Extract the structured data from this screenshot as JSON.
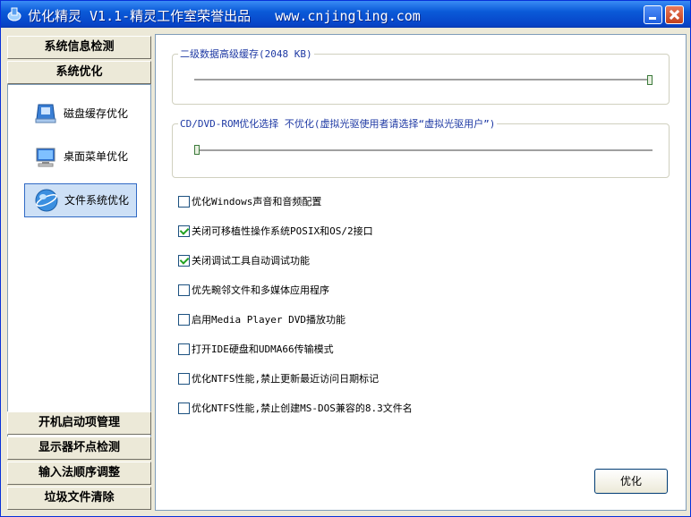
{
  "window": {
    "title": "优化精灵 V1.1-精灵工作室荣誉出品   www.cnjingling.com"
  },
  "sidebar": {
    "top_buttons": [
      {
        "label": "系统信息检测"
      },
      {
        "label": "系统优化"
      }
    ],
    "items": [
      {
        "label": "磁盘缓存优化",
        "icon": "disk-icon",
        "selected": false
      },
      {
        "label": "桌面菜单优化",
        "icon": "monitor-icon",
        "selected": false
      },
      {
        "label": "文件系统优化",
        "icon": "globe-icon",
        "selected": true
      }
    ],
    "bottom_buttons": [
      {
        "label": "开机启动项管理"
      },
      {
        "label": "显示器坏点检测"
      },
      {
        "label": "输入法顺序调整"
      },
      {
        "label": "垃圾文件清除"
      }
    ]
  },
  "main": {
    "l2cache": {
      "label": "二级数据高级缓存(2048 KB)",
      "slider_fraction": 1.0
    },
    "cdrom": {
      "label": "CD/DVD-ROM优化选择 不优化(虚拟光驱使用者请选择“虚拟光驱用户”)",
      "slider_fraction": 0.0
    },
    "options": [
      {
        "label": "优化Windows声音和音频配置",
        "checked": false
      },
      {
        "label": "关闭可移植性操作系统POSIX和OS/2接口",
        "checked": true
      },
      {
        "label": "关闭调试工具自动调试功能",
        "checked": true
      },
      {
        "label": "优先畹邻文件和多媒体应用程序",
        "checked": false
      },
      {
        "label": "启用Media Player DVD播放功能",
        "checked": false
      },
      {
        "label": "打开IDE硬盘和UDMA66传输模式",
        "checked": false
      },
      {
        "label": "优化NTFS性能,禁止更新最近访问日期标记",
        "checked": false
      },
      {
        "label": "优化NTFS性能,禁止创建MS-DOS兼容的8.3文件名",
        "checked": false
      }
    ],
    "optimize_button": "优化"
  },
  "colors": {
    "titlebar": "#0a5ad8",
    "selection": "#cde0f6",
    "group_label": "#1f3aa4"
  }
}
